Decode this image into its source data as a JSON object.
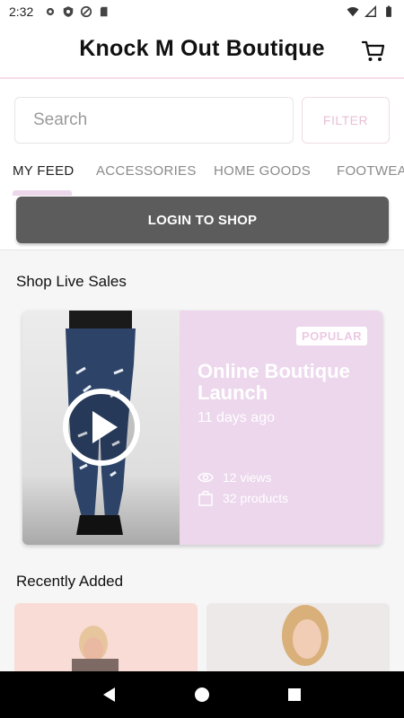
{
  "status_bar": {
    "time": "2:32",
    "icons": [
      "settings-icon",
      "shield-icon",
      "do-not-disturb-icon",
      "sd-card-icon"
    ],
    "right_icons": [
      "wifi-icon",
      "signal-icon",
      "battery-icon"
    ]
  },
  "header": {
    "title": "Knock M Out Boutique",
    "cart_icon": "cart-icon"
  },
  "search": {
    "placeholder": "Search",
    "value": "",
    "filter_label": "FILTER"
  },
  "tabs": [
    {
      "label": "MY FEED",
      "active": true
    },
    {
      "label": "ACCESSORIES",
      "active": false
    },
    {
      "label": "HOME GOODS",
      "active": false
    },
    {
      "label": "FOOTWEA",
      "active": false
    }
  ],
  "login_button": "LOGIN TO SHOP",
  "live_sales": {
    "heading": "Shop Live Sales",
    "card": {
      "badge": "POPULAR",
      "title": "Online Boutique Launch",
      "age": "11 days ago",
      "views": "12 views",
      "products": "32 products"
    }
  },
  "recently_added": {
    "heading": "Recently Added"
  },
  "colors": {
    "accent_pink": "#ecd7ec",
    "badge_text": "#ecc8e3",
    "login_bg": "#5c5c5c"
  }
}
